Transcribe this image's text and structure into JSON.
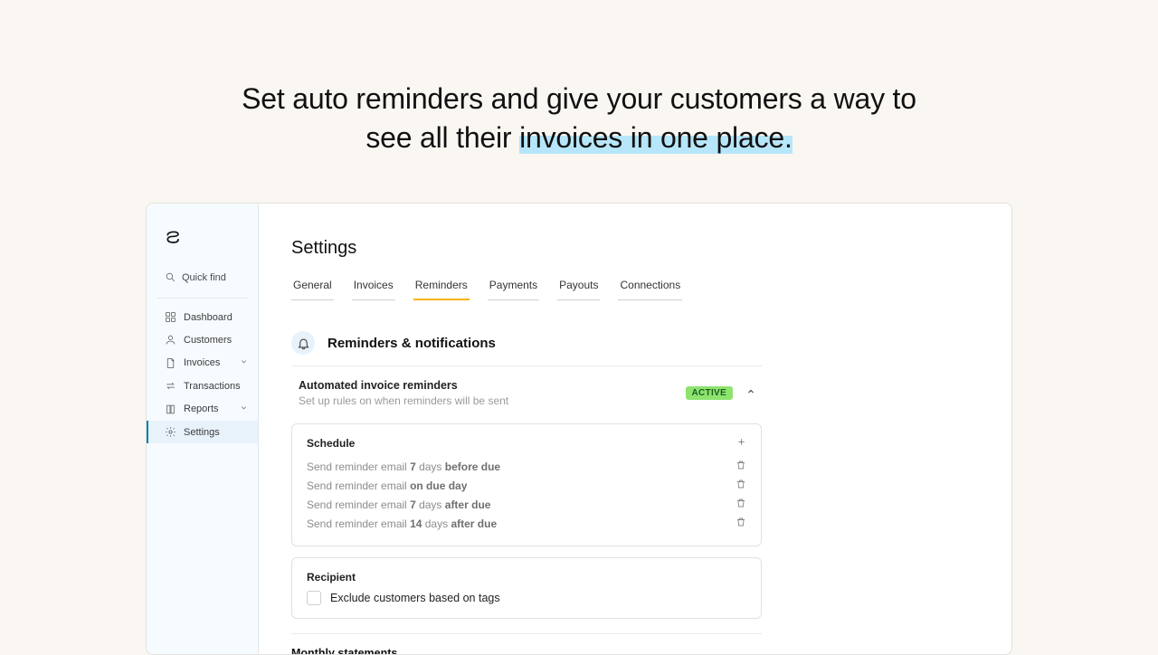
{
  "hero": {
    "line1": "Set auto reminders and give your customers a way to",
    "line2_pre": "see all their ",
    "line2_hl": "invoices in one place."
  },
  "sidebar": {
    "quickfind": "Quick find",
    "items": [
      {
        "label": "Dashboard",
        "icon": "grid-icon"
      },
      {
        "label": "Customers",
        "icon": "user-icon"
      },
      {
        "label": "Invoices",
        "icon": "file-icon",
        "expandable": true
      },
      {
        "label": "Transactions",
        "icon": "swap-icon"
      },
      {
        "label": "Reports",
        "icon": "book-icon",
        "expandable": true
      },
      {
        "label": "Settings",
        "icon": "gear-icon",
        "active": true
      }
    ]
  },
  "page": {
    "title": "Settings"
  },
  "tabs": [
    "General",
    "Invoices",
    "Reminders",
    "Payments",
    "Payouts",
    "Connections"
  ],
  "active_tab": "Reminders",
  "section": {
    "title": "Reminders & notifications"
  },
  "auto_reminders": {
    "title": "Automated invoice reminders",
    "desc": "Set up rules on when reminders will be sent",
    "status": "ACTIVE"
  },
  "schedule": {
    "title": "Schedule",
    "rules": [
      {
        "prefix": "Send reminder email ",
        "num": "7",
        "mid": " days ",
        "bold": "before due"
      },
      {
        "prefix": "Send reminder email ",
        "num": "",
        "mid": "",
        "bold": "on due day"
      },
      {
        "prefix": "Send reminder email ",
        "num": "7",
        "mid": " days ",
        "bold": "after due"
      },
      {
        "prefix": "Send reminder email ",
        "num": "14",
        "mid": " days ",
        "bold": "after due"
      }
    ]
  },
  "recipient": {
    "title": "Recipient",
    "exclude_label": "Exclude customers based on tags"
  },
  "monthly": {
    "title": "Monthly statements"
  }
}
